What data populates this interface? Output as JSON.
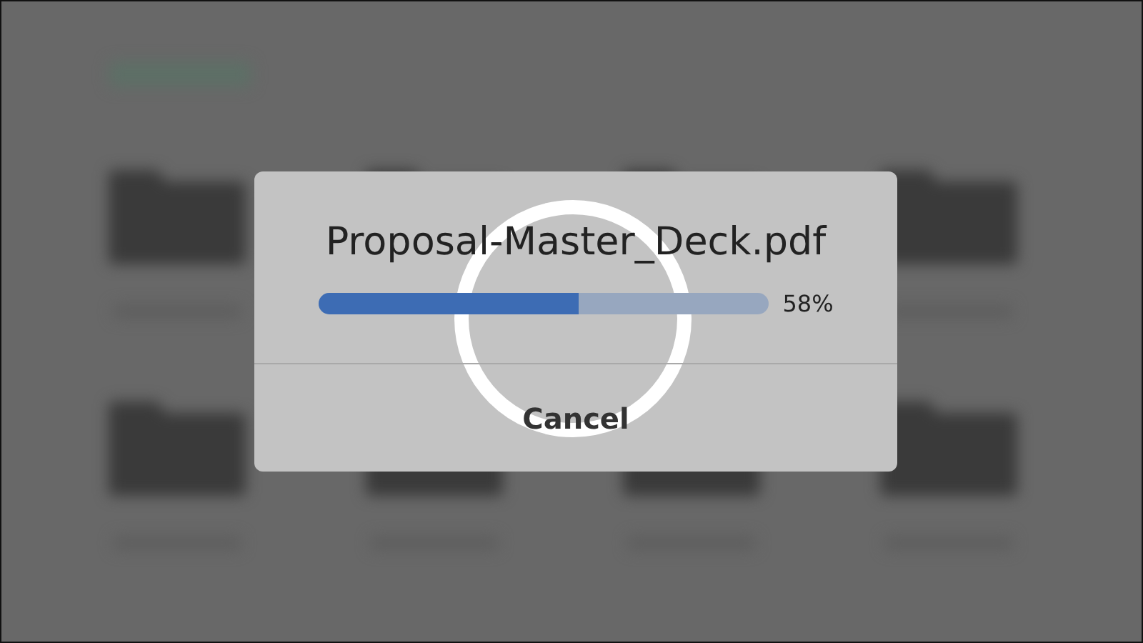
{
  "dialog": {
    "title": "Proposal-Master_Deck.pdf",
    "progress": {
      "level": 0.58,
      "reading": "58%"
    },
    "buttons": [
      "Cancel"
    ]
  }
}
